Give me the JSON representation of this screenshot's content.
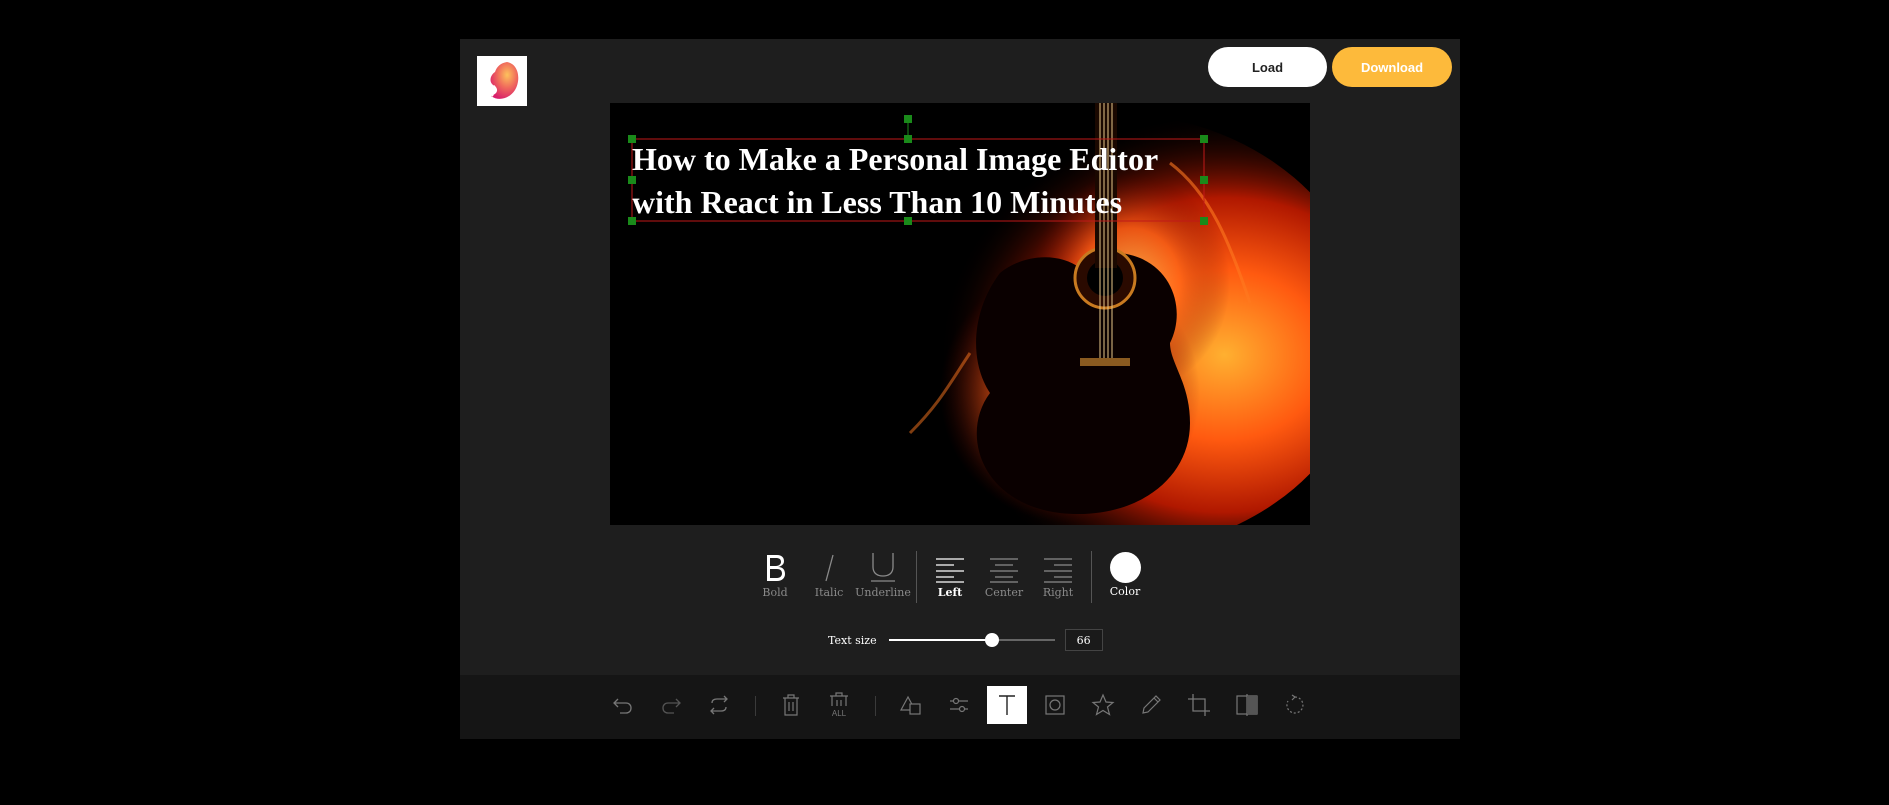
{
  "header": {
    "logo_icon": "brand-logo-icon",
    "load_label": "Load",
    "download_label": "Download",
    "download_color": "#fdba3b"
  },
  "canvas": {
    "headline": "How to Make a Personal Image Editor\nwith React in Less Than 10 Minutes",
    "background_image": "flaming-guitar-photo",
    "selection_color": "#1a8a1a"
  },
  "text_menu": {
    "style": [
      {
        "label": "Bold",
        "icon": "bold-icon"
      },
      {
        "label": "Italic",
        "icon": "italic-icon"
      },
      {
        "label": "Underline",
        "icon": "underline-icon"
      }
    ],
    "align": [
      {
        "label": "Left",
        "icon": "align-left-icon",
        "active": true
      },
      {
        "label": "Center",
        "icon": "align-center-icon"
      },
      {
        "label": "Right",
        "icon": "align-right-icon"
      }
    ],
    "color": {
      "label": "Color",
      "value": "#ffffff"
    },
    "text_size": {
      "label": "Text size",
      "value": "66",
      "min": 10,
      "max": 100
    }
  },
  "toolbar": {
    "items": [
      "undo-icon",
      "redo-icon",
      "reset-icon",
      "delete-icon",
      "delete-all-icon",
      "shape-icon",
      "filter-icon",
      "text-icon",
      "mask-icon",
      "icon-tool-icon",
      "draw-icon",
      "crop-icon",
      "flip-icon",
      "rotate-icon"
    ],
    "delete_all_caption": "ALL",
    "active": "text-icon"
  }
}
